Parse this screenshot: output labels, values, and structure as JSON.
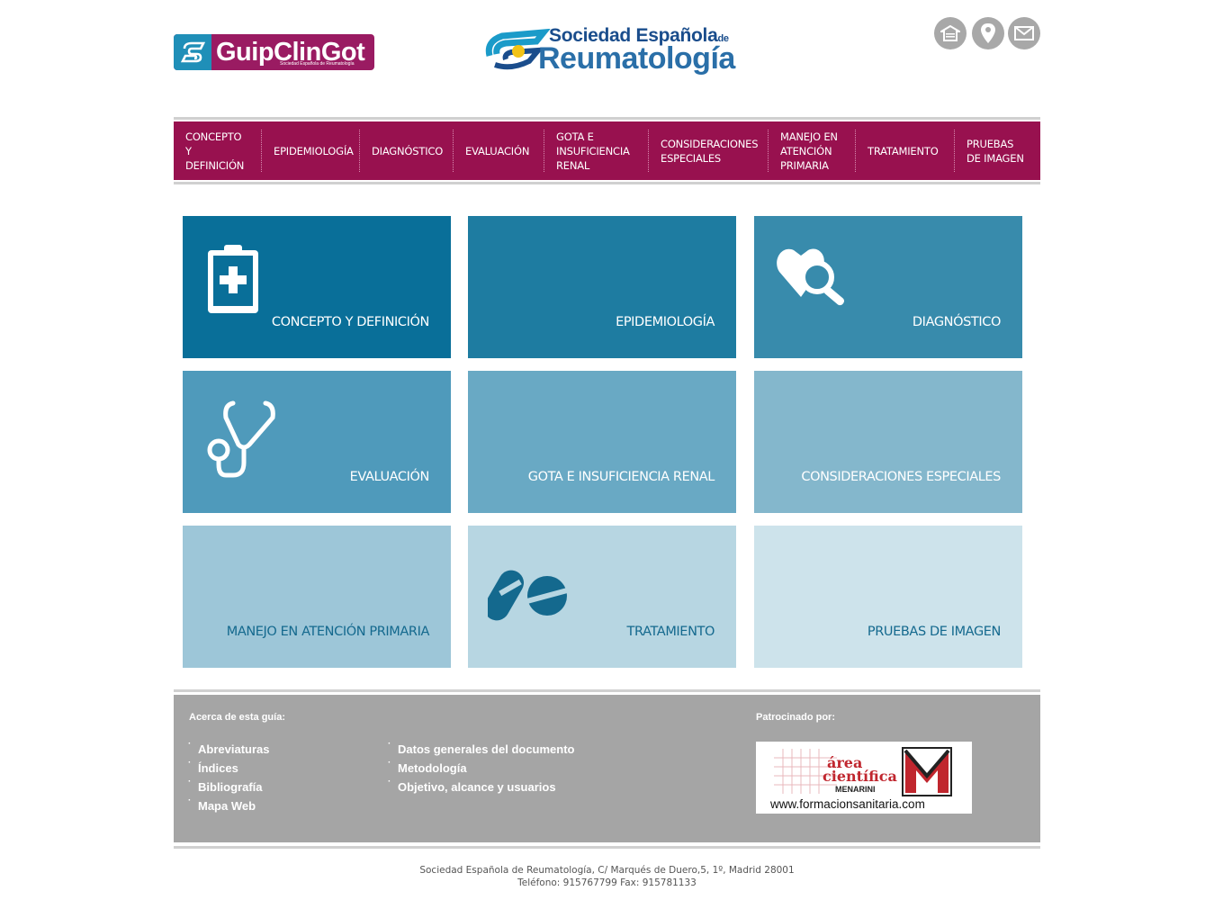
{
  "header": {
    "guip_logo_text": "GuipClinGot",
    "guip_logo_sub": "Sociedad Española de Reumatología",
    "ser_logo_line1": "Sociedad Española",
    "ser_logo_de": "de",
    "ser_logo_line2": "Reumatología",
    "icons": [
      "home-icon",
      "location-icon",
      "mail-icon"
    ]
  },
  "nav": {
    "items": [
      {
        "label": "CONCEPTO Y DEFINICIÓN"
      },
      {
        "label": "EPIDEMIOLOGÍA"
      },
      {
        "label": "DIAGNÓSTICO"
      },
      {
        "label": "EVALUACIÓN"
      },
      {
        "label": "GOTA E INSUFICIENCIA RENAL"
      },
      {
        "label": "CONSIDERACIONES ESPECIALES"
      },
      {
        "label": "MANEJO EN ATENCIÓN PRIMARIA"
      },
      {
        "label": "TRATAMIENTO"
      },
      {
        "label": "PRUEBAS DE IMAGEN"
      }
    ],
    "color": "#98114f"
  },
  "tiles": [
    {
      "label": "CONCEPTO Y DEFINICIÓN",
      "icon": "clipboard-medical-icon",
      "color": "#096f99"
    },
    {
      "label": "EPIDEMIOLOGÍA",
      "icon": "",
      "color": "#1e7ca1"
    },
    {
      "label": "DIAGNÓSTICO",
      "icon": "heart-search-icon",
      "color": "#388bac"
    },
    {
      "label": "EVALUACIÓN",
      "icon": "stethoscope-icon",
      "color": "#4f9abb"
    },
    {
      "label": "GOTA E INSUFICIENCIA RENAL",
      "icon": "",
      "color": "#69a9c4"
    },
    {
      "label": "CONSIDERACIONES ESPECIALES",
      "icon": "",
      "color": "#84b7cc"
    },
    {
      "label": "MANEJO EN ATENCIÓN PRIMARIA",
      "icon": "",
      "color": "#9dc6d8"
    },
    {
      "label": "TRATAMIENTO",
      "icon": "pills-icon",
      "color": "#b7d6e2"
    },
    {
      "label": "PRUEBAS DE IMAGEN",
      "icon": "",
      "color": "#cde3eb"
    }
  ],
  "footer": {
    "about_heading": "Acerca de esta guía:",
    "col1": [
      "Abreviaturas",
      "Índices",
      "Bibliografía",
      "Mapa Web"
    ],
    "col2": [
      "Datos generales del documento",
      "Metodología",
      "Objetivo, alcance y usuarios"
    ],
    "sponsor_heading": "Patrocinado por:",
    "sponsor_line1": "área",
    "sponsor_line2": "científica",
    "sponsor_line3": "MENARINI",
    "sponsor_url": "www.formacionsanitaria.com",
    "sponsor_m": "M",
    "sponsor_vertical": "MENARINI"
  },
  "address": {
    "line1": "Sociedad Española de Reumatología, C/ Marqués de Duero,5, 1º, Madrid 28001",
    "line2": "Teléfono: 915767799 Fax: 915781133"
  }
}
